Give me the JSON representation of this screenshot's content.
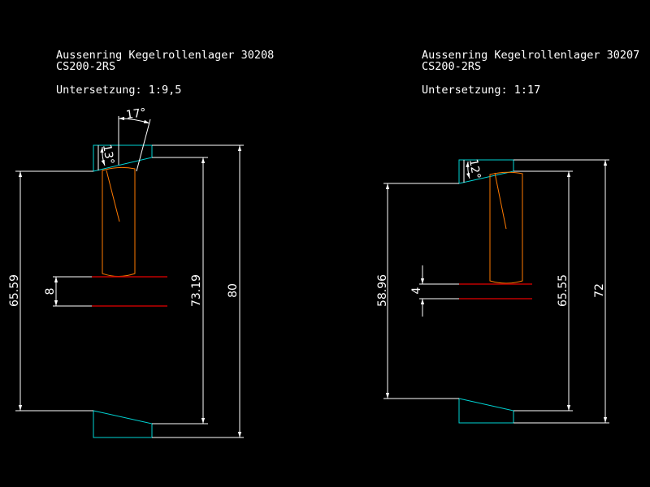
{
  "left": {
    "title_line1": "Aussenring Kegelrollenlager 30208",
    "title_line2": "CS200-2RS",
    "ratio_label": "Untersetzung: 1:9,5",
    "angle_top": "17°",
    "angle_side": "13°",
    "dim_inner": "65.59",
    "dim_gap": "8",
    "dim_mid": "73.19",
    "dim_outer": "80"
  },
  "right": {
    "title_line1": "Aussenring Kegelrollenlager 30207",
    "title_line2": "CS200-2RS",
    "ratio_label": "Untersetzung: 1:17",
    "angle_side": "12°",
    "dim_inner": "58.96",
    "dim_gap": "4",
    "dim_mid": "65.55",
    "dim_outer": "72"
  },
  "colors": {
    "background": "#000000",
    "dimension": "#ffffff",
    "ring": "#00d4d4",
    "roller": "#ff7a00",
    "axis": "#c00000"
  }
}
